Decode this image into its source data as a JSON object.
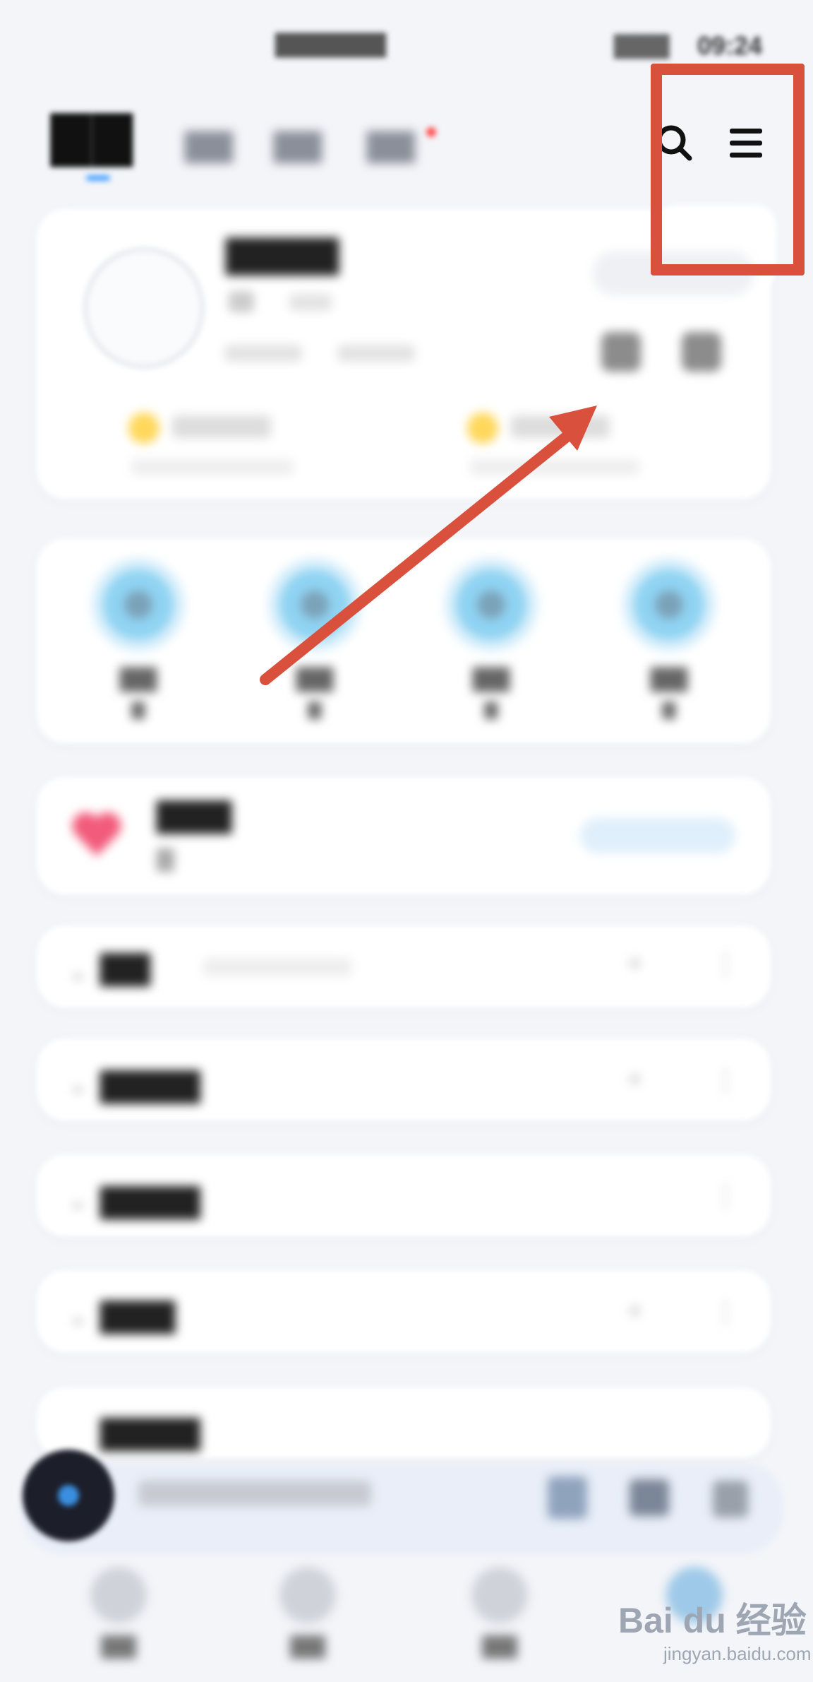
{
  "status_bar": {
    "center": "",
    "right": "",
    "time": "09:24"
  },
  "header": {
    "title": "",
    "tabs": [
      "",
      "",
      ""
    ]
  },
  "profile": {
    "nickname": "",
    "vip_button": "",
    "promos": [
      {
        "title": "",
        "subtitle": ""
      },
      {
        "title": "",
        "subtitle": ""
      }
    ]
  },
  "shortcuts": [
    {
      "label": "",
      "count": ""
    },
    {
      "label": "",
      "count": ""
    },
    {
      "label": "",
      "count": ""
    },
    {
      "label": "",
      "count": ""
    }
  ],
  "liked": {
    "title": "",
    "count": "",
    "button": ""
  },
  "sections": [
    {
      "title": "",
      "subtitle": ""
    },
    {
      "title": "",
      "subtitle": ""
    },
    {
      "title": "",
      "subtitle": ""
    },
    {
      "title": "",
      "subtitle": ""
    },
    {
      "title": "",
      "subtitle": ""
    }
  ],
  "mini_player": {
    "song": ""
  },
  "bottom_nav": [
    "",
    "",
    "",
    ""
  ],
  "watermark": {
    "logo": "Bai du 经验",
    "url": "jingyan.baidu.com"
  },
  "colors": {
    "annotation": "#d9503c",
    "accent": "#4aa3ff",
    "heart": "#f25b7b"
  },
  "icons": [
    "search-icon",
    "menu-icon"
  ]
}
